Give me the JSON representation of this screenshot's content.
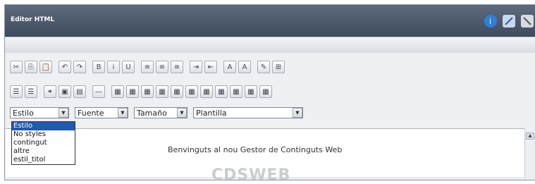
{
  "window": {
    "title": "Editor HTML"
  },
  "title_icons": [
    {
      "name": "info-icon",
      "color": "#2f7fd8"
    },
    {
      "name": "edit-icon",
      "color": "#6f9bd6"
    },
    {
      "name": "close-icon",
      "color": "#9ea7b3"
    }
  ],
  "toolbar_row1": [
    {
      "name": "cut-icon",
      "glyph": "✂"
    },
    {
      "name": "copy-icon",
      "glyph": "⎘"
    },
    {
      "name": "paste-icon",
      "glyph": "📋"
    },
    {
      "name": "undo-icon",
      "glyph": "↶"
    },
    {
      "name": "redo-icon",
      "glyph": "↷"
    },
    {
      "name": "bold-icon",
      "glyph": "B"
    },
    {
      "name": "italic-icon",
      "glyph": "i"
    },
    {
      "name": "underline-icon",
      "glyph": "U"
    },
    {
      "name": "align-left-icon",
      "glyph": "≡"
    },
    {
      "name": "align-center-icon",
      "glyph": "≡"
    },
    {
      "name": "align-right-icon",
      "glyph": "≡"
    },
    {
      "name": "indent-icon",
      "glyph": "⇥"
    },
    {
      "name": "outdent-icon",
      "glyph": "⇤"
    },
    {
      "name": "font-color-icon",
      "glyph": "A"
    },
    {
      "name": "highlight-icon",
      "glyph": "A"
    },
    {
      "name": "source-edit-icon",
      "glyph": "✎"
    },
    {
      "name": "table-border-icon",
      "glyph": "⊞"
    }
  ],
  "toolbar_row2": [
    {
      "name": "numbered-list-icon",
      "glyph": "☰"
    },
    {
      "name": "bullet-list-icon",
      "glyph": "☰"
    },
    {
      "name": "link-icon",
      "glyph": "⚭"
    },
    {
      "name": "image-icon",
      "glyph": "▣"
    },
    {
      "name": "media-icon",
      "glyph": "▤"
    },
    {
      "name": "horizontal-rule-icon",
      "glyph": "—"
    },
    {
      "name": "insert-table-icon",
      "glyph": "▦"
    },
    {
      "name": "table-props-icon",
      "glyph": "▦"
    },
    {
      "name": "cell-props-icon",
      "glyph": "▦"
    },
    {
      "name": "insert-row-icon",
      "glyph": "▦"
    },
    {
      "name": "insert-column-icon",
      "glyph": "▦"
    },
    {
      "name": "delete-row-icon",
      "glyph": "▦"
    },
    {
      "name": "delete-column-icon",
      "glyph": "▦"
    },
    {
      "name": "merge-cells-icon",
      "glyph": "▦"
    },
    {
      "name": "split-cells-icon",
      "glyph": "▦"
    },
    {
      "name": "table-row-props-icon",
      "glyph": "▦"
    },
    {
      "name": "table-cell-align-icon",
      "glyph": "▦"
    }
  ],
  "selects": {
    "style": "Estilo",
    "font": "Fuente",
    "size": "Tamaño",
    "template": "Plantilla"
  },
  "style_dropdown": {
    "options": [
      "Estilo",
      "No styles",
      "contingut",
      "altre",
      "estil_titol"
    ],
    "selected": "Estilo"
  },
  "editor": {
    "welcome_text": "Benvinguts al nou Gestor de Continguts Web",
    "logo_text": "CDSWEB"
  }
}
